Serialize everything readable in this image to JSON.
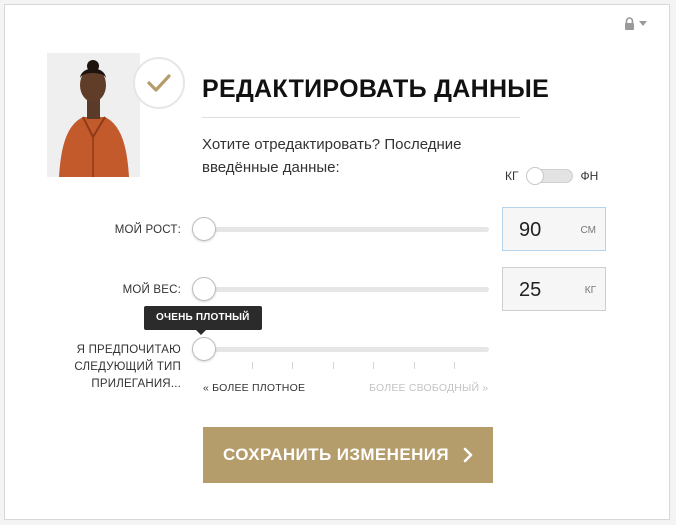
{
  "header": {
    "title": "РЕДАКТИРОВАТЬ ДАННЫЕ",
    "prompt": "Хотите отредактировать? Последние введённые данные:"
  },
  "unit_toggle": {
    "left_label": "КГ",
    "right_label": "ФН",
    "selected": "КГ"
  },
  "height": {
    "label": "МОЙ РОСТ:",
    "value": "90",
    "unit": "СМ",
    "slider_fraction": 0
  },
  "weight": {
    "label": "МОЙ ВЕС:",
    "value": "25",
    "unit": "КГ",
    "slider_fraction": 0
  },
  "fit": {
    "label": "Я ПРЕДПОЧИТАЮ СЛЕДУЮЩИЙ ТИП ПРИЛЕГАНИЯ...",
    "tooltip": "ОЧЕНЬ ПЛОТНЫЙ",
    "min_label": "« БОЛЕЕ ПЛОТНОЕ",
    "max_label": "БОЛЕЕ СВОБОДНЫЙ »",
    "slider_fraction": 0,
    "tick_count": 7
  },
  "save_button": {
    "label": "СОХРАНИТЬ ИЗМЕНЕНИЯ"
  },
  "colors": {
    "accent_gold": "#b59c6b",
    "check_gold": "#b59c6b",
    "muted_text": "#c4c4c4"
  },
  "icons": {
    "lock": "lock-icon",
    "dropdown": "caret-down-icon",
    "check": "check-icon",
    "chevron": "chevron-right-icon"
  }
}
